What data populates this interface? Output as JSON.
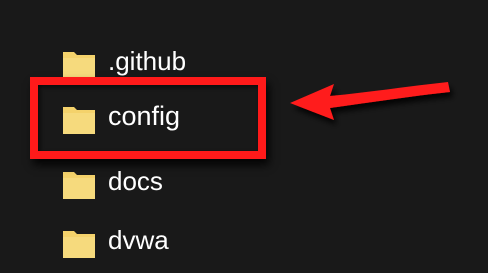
{
  "folders": [
    {
      "name": ".github",
      "icon": "folder-icon"
    },
    {
      "name": "config",
      "icon": "folder-icon"
    },
    {
      "name": "docs",
      "icon": "folder-icon"
    },
    {
      "name": "dvwa",
      "icon": "folder-icon"
    }
  ],
  "highlighted_folder": "config",
  "colors": {
    "background": "#191919",
    "text": "#ffffff",
    "folder": "#f4d26b",
    "annotation": "#ff1a1a"
  }
}
